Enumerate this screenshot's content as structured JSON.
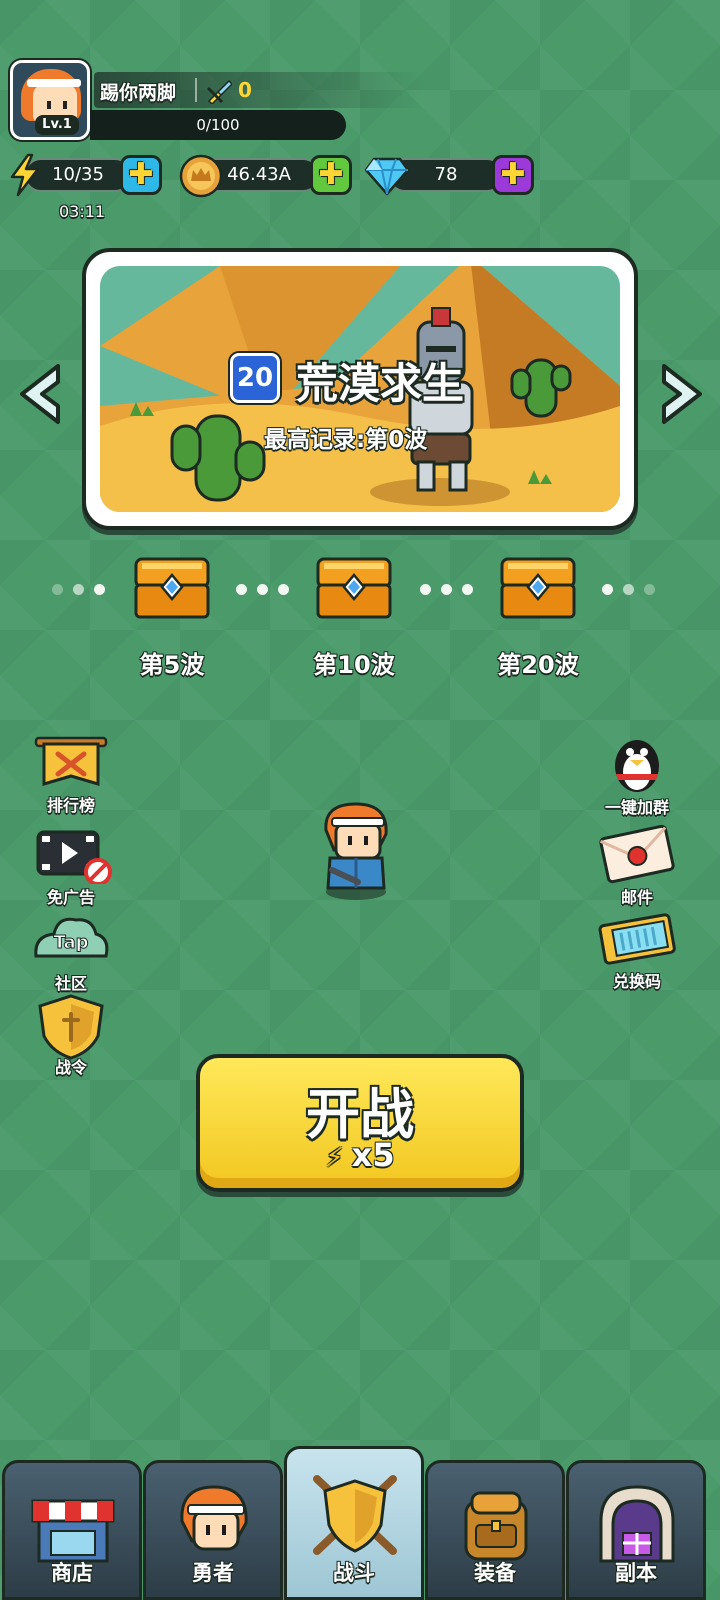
{
  "player": {
    "name": "踢你两脚",
    "level": "Lv.1",
    "power": "0",
    "exp_text": "0/100",
    "exp_fraction": 0
  },
  "resources": {
    "energy": "10/35",
    "energy_timer": "03:11",
    "gold": "46.43A",
    "gems": "78"
  },
  "stage": {
    "number": "20",
    "title": "荒漠求生",
    "record": "最高记录:第0波"
  },
  "wave_rewards": [
    {
      "label": "第5波"
    },
    {
      "label": "第10波"
    },
    {
      "label": "第20波"
    }
  ],
  "left_menu": [
    {
      "label": "排行榜",
      "icon": "leaderboard-banner-icon"
    },
    {
      "label": "免广告",
      "icon": "no-ads-film-icon"
    },
    {
      "label": "社区",
      "icon": "tap-community-icon"
    },
    {
      "label": "战令",
      "icon": "battle-pass-shield-icon"
    }
  ],
  "right_menu": [
    {
      "label": "一键加群",
      "icon": "qq-penguin-icon"
    },
    {
      "label": "邮件",
      "icon": "mail-envelope-icon"
    },
    {
      "label": "兑换码",
      "icon": "redeem-ticket-icon"
    }
  ],
  "start_button": {
    "label": "开战",
    "cost": "x5"
  },
  "bottom_nav": [
    {
      "label": "商店",
      "icon": "shop-icon",
      "active": false
    },
    {
      "label": "勇者",
      "icon": "hero-icon",
      "active": false
    },
    {
      "label": "战斗",
      "icon": "battle-shield-icon",
      "active": true
    },
    {
      "label": "装备",
      "icon": "backpack-icon",
      "active": false
    },
    {
      "label": "副本",
      "icon": "dungeon-gate-icon",
      "active": false
    }
  ],
  "colors": {
    "background": "#4a9a6a",
    "start_button": "#f5cf2a",
    "energy_plus": "#2eb8e8",
    "gold_plus": "#62c83e",
    "gem_plus": "#9b3ad8",
    "power_text": "#ffd534"
  }
}
